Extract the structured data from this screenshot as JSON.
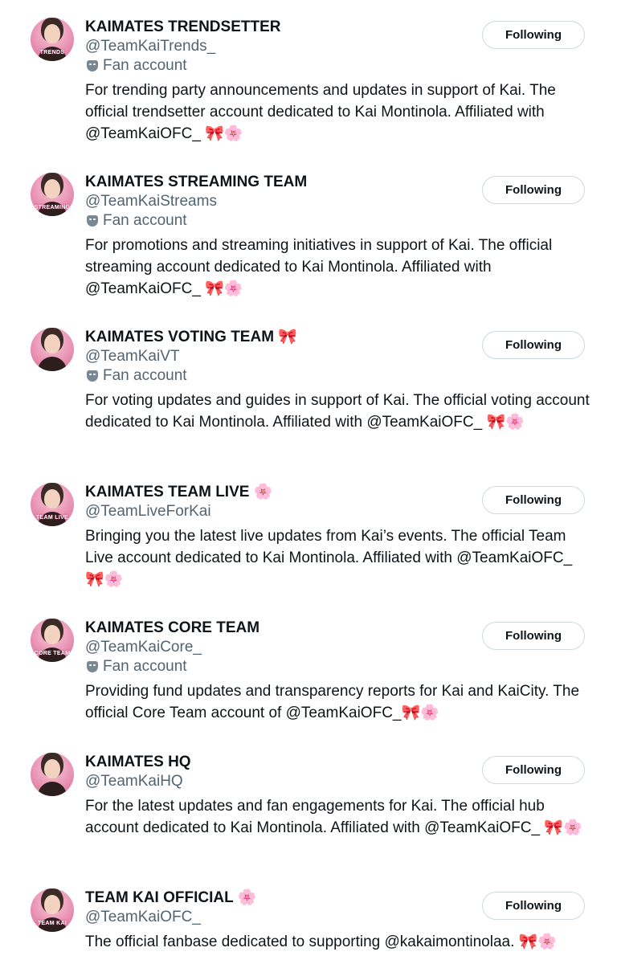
{
  "follow_label": "Following",
  "fan_account_label": "Fan account",
  "accounts": [
    {
      "name": "KAIMATES TRENDSETTER",
      "handle": "@TeamKaiTrends_",
      "bio": "For trending party announcements and updates in support of Kai. The official trendsetter account dedicated to Kai Montinola. Affiliated with @TeamKaiOFC_ 🎀🌸",
      "avatar_text": "TRENDS"
    },
    {
      "name": "KAIMATES STREAMING TEAM",
      "handle": "@TeamKaiStreams",
      "bio": "For promotions and streaming initiatives in support of Kai. The official streaming account dedicated to Kai Montinola. Affiliated with @TeamKaiOFC_ 🎀🌸",
      "avatar_text": "STREAMING"
    },
    {
      "name": "KAIMATES VOTING TEAM 🎀",
      "handle": "@TeamKaiVT",
      "bio": "For voting updates and guides in support of Kai. The official voting account dedicated to Kai Montinola. Affiliated with @TeamKaiOFC_ 🎀🌸",
      "avatar_text": ""
    },
    {
      "name": "KAIMATES TEAM LIVE 🌸",
      "handle": "@TeamLiveForKai",
      "bio": "Bringing you the latest live updates from Kai’s events. The official Team Live account dedicated to Kai Montinola. Affiliated with @TeamKaiOFC_ 🎀🌸",
      "avatar_text": "TEAM LIVE"
    },
    {
      "name": "KAIMATES CORE TEAM",
      "handle": "@TeamKaiCore_",
      "bio": "Providing fund updates and transparency reports for Kai and KaiCity. The official Core Team account of @TeamKaiOFC_🎀🌸",
      "avatar_text": "CORE TEAM"
    },
    {
      "name": "KAIMATES HQ",
      "handle": "@TeamKaiHQ",
      "bio": "For the latest updates and fan engagements for Kai. The official hub account dedicated to Kai Montinola. Affiliated with @TeamKaiOFC_ 🎀🌸",
      "avatar_text": ""
    },
    {
      "name": "TEAM KAI OFFICIAL 🌸",
      "handle": "@TeamKaiOFC_",
      "bio": "The official fanbase dedicated to supporting @kakaimontinolaa. 🎀🌸",
      "avatar_text": "TEAM KAI"
    }
  ]
}
